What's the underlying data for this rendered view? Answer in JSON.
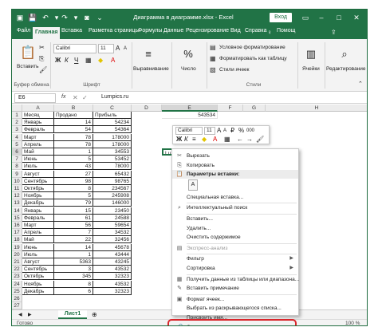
{
  "window": {
    "title": "Диаграмма в диаграмме.xlsx  -  Excel",
    "login_label": "Вход",
    "accent": "#217346"
  },
  "tabs": [
    "Файл",
    "Главная",
    "Вставка",
    "Разметка страницы",
    "Формулы",
    "Данные",
    "Рецензирование",
    "Вид",
    "Справка",
    "Помощ"
  ],
  "ribbon": {
    "paste_label": "Вставить",
    "font_name": "Calibri",
    "font_size": "11",
    "align_label": "Выравнивание",
    "number_label": "Число",
    "cond_format": "Условное форматирование",
    "format_table": "Форматировать как таблицу",
    "cell_styles": "Стили ячеек",
    "cells_label": "Ячейки",
    "editing_label": "Редактирование",
    "groups": [
      "Буфер обмена",
      "Шрифт",
      "Стили"
    ]
  },
  "formula_bar": {
    "name_box": "E6",
    "fx": "fx",
    "value": "Lumpics.ru"
  },
  "columns": [
    "A",
    "B",
    "C",
    "D",
    "E",
    "F",
    "G",
    "H"
  ],
  "rows": [
    "1",
    "2",
    "3",
    "4",
    "5",
    "6",
    "7",
    "8",
    "9",
    "10",
    "11",
    "12",
    "13",
    "14",
    "15",
    "16",
    "17",
    "18",
    "19",
    "20",
    "21",
    "22",
    "23",
    "24",
    "25",
    "26",
    "27"
  ],
  "table": {
    "headers": [
      "Месяц",
      "Продано",
      "Прибыль"
    ],
    "data": [
      [
        "Январь",
        "14",
        "54234"
      ],
      [
        "Февраль",
        "54",
        "54364"
      ],
      [
        "Март",
        "78",
        "178000"
      ],
      [
        "Апрель",
        "78",
        "178000"
      ],
      [
        "Май",
        "1",
        "34553"
      ],
      [
        "Июнь",
        "5",
        "53452"
      ],
      [
        "Июль",
        "43",
        "78000"
      ],
      [
        "Август",
        "27",
        "65432"
      ],
      [
        "Сентябрь",
        "98",
        "98765"
      ],
      [
        "Октябрь",
        "8",
        "234567"
      ],
      [
        "Ноябрь",
        "5",
        "245908"
      ],
      [
        "Декабрь",
        "79",
        "146000"
      ],
      [
        "Январь",
        "15",
        "23450"
      ],
      [
        "Февраль",
        "61",
        "24588"
      ],
      [
        "Март",
        "56",
        "59654"
      ],
      [
        "Апрель",
        "7",
        "34532"
      ],
      [
        "Май",
        "22",
        "32456"
      ],
      [
        "Июнь",
        "14",
        "45678"
      ],
      [
        "Июль",
        "1",
        "43444"
      ],
      [
        "Август",
        "5363",
        "43245"
      ],
      [
        "Сентябрь",
        "3",
        "43532"
      ],
      [
        "Октябрь",
        "345",
        "32323"
      ],
      [
        "Ноябрь",
        "8",
        "43532"
      ],
      [
        "Декабрь",
        "6",
        "32323"
      ]
    ],
    "e1_value": "543534",
    "e6_value": "Lu"
  },
  "mini_toolbar": {
    "font": "Calibri",
    "size": "11",
    "currency": "₽",
    "percent": "%",
    "thousands": "000"
  },
  "context_menu": [
    {
      "label": "Вырезать",
      "icon": "cut-icon",
      "state": "normal"
    },
    {
      "label": "Копировать",
      "icon": "copy-icon",
      "state": "normal"
    },
    {
      "label": "Параметры вставки:",
      "icon": "paste-icon",
      "state": "header"
    },
    {
      "label": "Специальная вставка...",
      "icon": "",
      "state": "normal"
    },
    {
      "label": "Интеллектуальный поиск",
      "icon": "search-icon",
      "state": "normal"
    },
    {
      "label": "Вставить...",
      "icon": "",
      "state": "normal"
    },
    {
      "label": "Удалить...",
      "icon": "",
      "state": "normal"
    },
    {
      "label": "Очистить содержимое",
      "icon": "",
      "state": "normal"
    },
    {
      "label": "Экспресс-анализ",
      "icon": "quick-analysis-icon",
      "state": "dim"
    },
    {
      "label": "Фильтр",
      "icon": "",
      "state": "submenu"
    },
    {
      "label": "Сортировка",
      "icon": "",
      "state": "submenu"
    },
    {
      "label": "Получить данные из таблицы или диапазона...",
      "icon": "table-icon",
      "state": "normal"
    },
    {
      "label": "Вставить примечание",
      "icon": "comment-icon",
      "state": "normal"
    },
    {
      "label": "Формат ячеек...",
      "icon": "format-cells-icon",
      "state": "normal"
    },
    {
      "label": "Выбрать из раскрывающегося списка...",
      "icon": "",
      "state": "normal"
    },
    {
      "label": "Присвоить имя...",
      "icon": "",
      "state": "normal"
    },
    {
      "label": "Ссылка",
      "icon": "link-icon",
      "state": "normal"
    }
  ],
  "sheet": {
    "tab_label": "Лист1",
    "status_label": "Готово",
    "zoom": "100 %"
  }
}
